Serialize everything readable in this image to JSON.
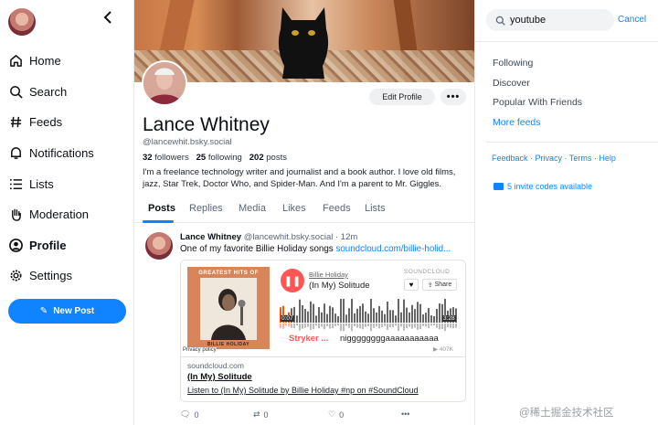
{
  "nav": {
    "items": [
      {
        "label": "Home",
        "icon": "home-icon"
      },
      {
        "label": "Search",
        "icon": "search-icon"
      },
      {
        "label": "Feeds",
        "icon": "hash-icon"
      },
      {
        "label": "Notifications",
        "icon": "bell-icon"
      },
      {
        "label": "Lists",
        "icon": "list-icon"
      },
      {
        "label": "Moderation",
        "icon": "hand-icon"
      },
      {
        "label": "Profile",
        "icon": "profile-icon",
        "active": true
      },
      {
        "label": "Settings",
        "icon": "gear-icon"
      }
    ],
    "new_post": "New Post"
  },
  "profile": {
    "edit_label": "Edit Profile",
    "more_label": "•••",
    "display_name": "Lance Whitney",
    "handle": "@lancewhit.bsky.social",
    "followers_count": "32",
    "followers_label": "followers",
    "following_count": "25",
    "following_label": "following",
    "posts_count": "202",
    "posts_label": "posts",
    "bio": "I'm a freelance technology writer and journalist and a book author. I love old films, jazz, Star Trek, Doctor Who, and Spider-Man. And I'm a parent to Mr. Giggles."
  },
  "tabs": [
    "Posts",
    "Replies",
    "Media",
    "Likes",
    "Feeds",
    "Lists"
  ],
  "post": {
    "author": "Lance Whitney",
    "handle": "@lancewhit.bsky.social",
    "time": "· 12m",
    "text": "One of my favorite Billie Holiday songs ",
    "link": "soundcloud.com/billie-holid...",
    "embed": {
      "album_title": "GREATEST HITS OF",
      "album_name": "BILLIE HOLIDAY",
      "privacy": "Privacy policy",
      "artist": "Billie Holiday",
      "track": "(In My) Solitude",
      "brand": "SOUNDCLOUD",
      "share": "Share",
      "time_start": "0:07",
      "time_end": "3:28",
      "comment_user": "Stryker ...",
      "comment_text": "niggggggggaaaaaaaaaaa",
      "plays": "▶ 407K",
      "domain": "soundcloud.com",
      "title": "(In My) Solitude",
      "description": "Listen to (In My) Solitude by Billie Holiday #np on #SoundCloud"
    },
    "actions": {
      "reply_count": "0",
      "repost_count": "0",
      "like_count": "0",
      "more": "•••"
    }
  },
  "right": {
    "search_value": "youtube",
    "cancel": "Cancel",
    "links": [
      "Following",
      "Discover",
      "Popular With Friends"
    ],
    "more_feeds": "More feeds",
    "footer": [
      "Feedback",
      "Privacy",
      "Terms",
      "Help"
    ],
    "footer_sep": " · ",
    "invite": "5 invite codes available"
  },
  "watermark": "@稀土掘金技术社区",
  "colors": {
    "accent": "#1083fe",
    "soundcloud": "#ff5500"
  }
}
